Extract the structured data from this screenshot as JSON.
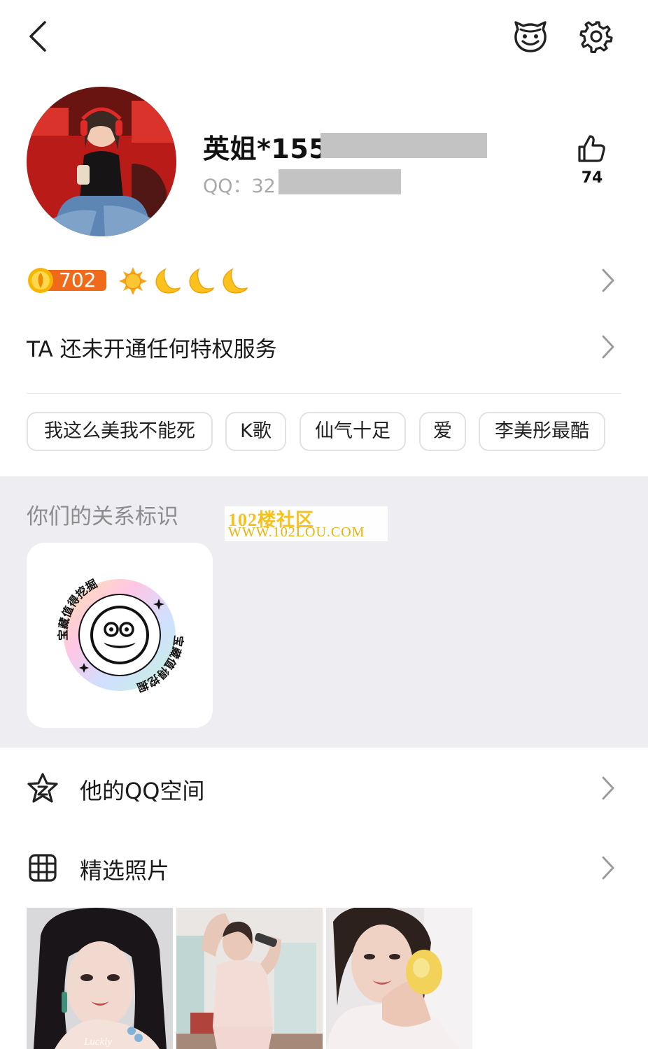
{
  "header": {
    "back_icon": "chevron-left-icon",
    "pet_icon": "pet-face-icon",
    "settings_icon": "gear-icon"
  },
  "profile": {
    "nickname": "英姐*155",
    "qq_label": "QQ：32",
    "likes_count": "74",
    "like_icon": "thumbs-up-icon"
  },
  "level": {
    "badge_value": "702",
    "icons": [
      "sun-icon",
      "moon-icon",
      "moon-icon",
      "moon-icon"
    ]
  },
  "privilege": {
    "text": "TA 还未开通任何特权服务"
  },
  "tags": [
    "我这么美我不能死",
    "K歌",
    "仙气十足",
    "爱",
    "李美彤最酷"
  ],
  "relationship": {
    "title": "你们的关系标识",
    "badge_text": "宝藏值得挖掘"
  },
  "watermark": {
    "line1": "102楼社区",
    "line2": "WWW.102LOU.COM"
  },
  "rows": [
    {
      "label": "他的QQ空间",
      "icon": "star-icon"
    },
    {
      "label": "精选照片",
      "icon": "grid-icon"
    }
  ],
  "photos": {
    "caption": "Luckly"
  },
  "colors": {
    "accent_orange": "#f06a1c",
    "badge_gold": "#f7b500",
    "section_bg": "#eeeef2",
    "mask_gray": "#c3c3c3"
  }
}
